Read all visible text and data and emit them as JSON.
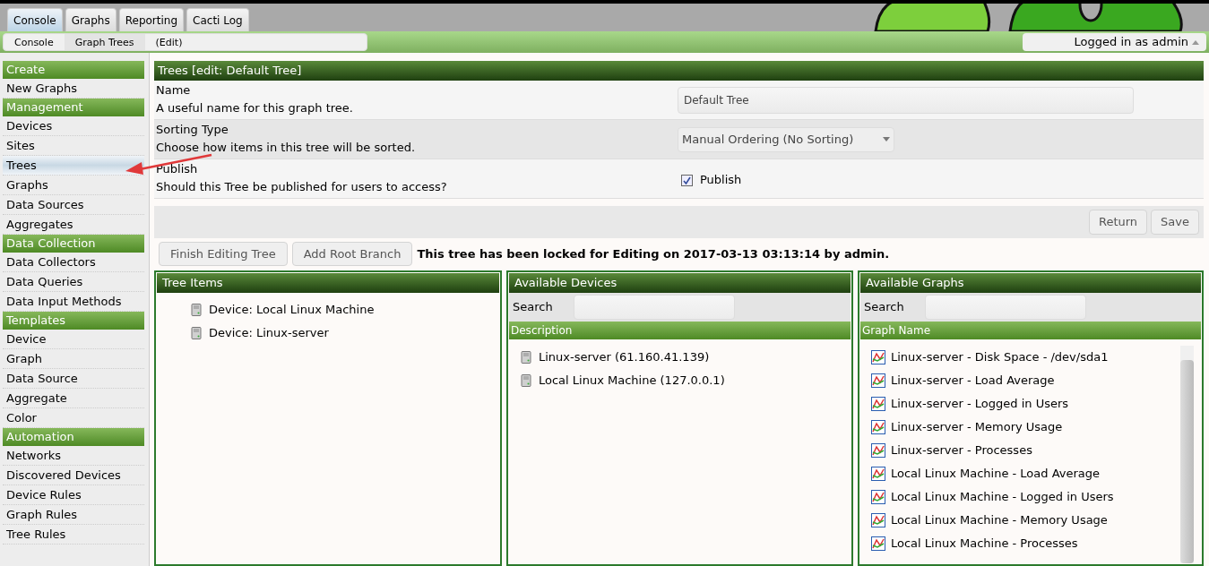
{
  "top_tabs": [
    {
      "label": "Console",
      "selected": true
    },
    {
      "label": "Graphs",
      "selected": false
    },
    {
      "label": "Reporting",
      "selected": false
    },
    {
      "label": "Cacti Log",
      "selected": false
    }
  ],
  "breadcrumb": [
    "Console",
    "Graph Trees",
    "(Edit)"
  ],
  "user_menu": "Logged in as admin",
  "sidebar": [
    {
      "heading": "Create",
      "items": [
        {
          "label": "New Graphs",
          "selected": false
        }
      ]
    },
    {
      "heading": "Management",
      "items": [
        {
          "label": "Devices",
          "selected": false
        },
        {
          "label": "Sites",
          "selected": false
        },
        {
          "label": "Trees",
          "selected": true
        },
        {
          "label": "Graphs",
          "selected": false
        },
        {
          "label": "Data Sources",
          "selected": false
        },
        {
          "label": "Aggregates",
          "selected": false
        }
      ]
    },
    {
      "heading": "Data Collection",
      "items": [
        {
          "label": "Data Collectors",
          "selected": false
        },
        {
          "label": "Data Queries",
          "selected": false
        },
        {
          "label": "Data Input Methods",
          "selected": false
        }
      ]
    },
    {
      "heading": "Templates",
      "items": [
        {
          "label": "Device",
          "selected": false
        },
        {
          "label": "Graph",
          "selected": false
        },
        {
          "label": "Data Source",
          "selected": false
        },
        {
          "label": "Aggregate",
          "selected": false
        },
        {
          "label": "Color",
          "selected": false
        }
      ]
    },
    {
      "heading": "Automation",
      "items": [
        {
          "label": "Networks",
          "selected": false
        },
        {
          "label": "Discovered Devices",
          "selected": false
        },
        {
          "label": "Device Rules",
          "selected": false
        },
        {
          "label": "Graph Rules",
          "selected": false
        },
        {
          "label": "Tree Rules",
          "selected": false
        }
      ]
    }
  ],
  "form": {
    "title": "Trees [edit: Default Tree]",
    "fields": [
      {
        "kind": "text",
        "label": "Name",
        "description": "A useful name for this graph tree.",
        "value": "Default Tree"
      },
      {
        "kind": "select",
        "label": "Sorting Type",
        "description": "Choose how items in this tree will be sorted.",
        "value": "Manual Ordering (No Sorting)"
      },
      {
        "kind": "checkbox",
        "label": "Publish",
        "description": "Should this Tree be published for users to access?",
        "value": "Publish",
        "checked": true
      }
    ]
  },
  "form_buttons": [
    "Return",
    "Save"
  ],
  "tree_actions": [
    "Finish Editing Tree",
    "Add Root Branch"
  ],
  "lock_message": "This tree has been locked for Editing on 2017-03-13 03:13:14 by admin.",
  "tree_items": {
    "title": "Tree Items",
    "items": [
      "Device: Local Linux Machine",
      "Device: Linux-server"
    ]
  },
  "devices": {
    "title": "Available Devices",
    "search_label": "Search",
    "column": "Description",
    "items": [
      "Linux-server (61.160.41.139)",
      "Local Linux Machine (127.0.0.1)"
    ]
  },
  "graphs": {
    "title": "Available Graphs",
    "search_label": "Search",
    "column": "Graph Name",
    "items": [
      "Linux-server - Disk Space - /dev/sda1",
      "Linux-server - Load Average",
      "Linux-server - Logged in Users",
      "Linux-server - Memory Usage",
      "Linux-server - Processes",
      "Local Linux Machine - Load Average",
      "Local Linux Machine - Logged in Users",
      "Local Linux Machine - Memory Usage",
      "Local Linux Machine - Processes"
    ]
  }
}
